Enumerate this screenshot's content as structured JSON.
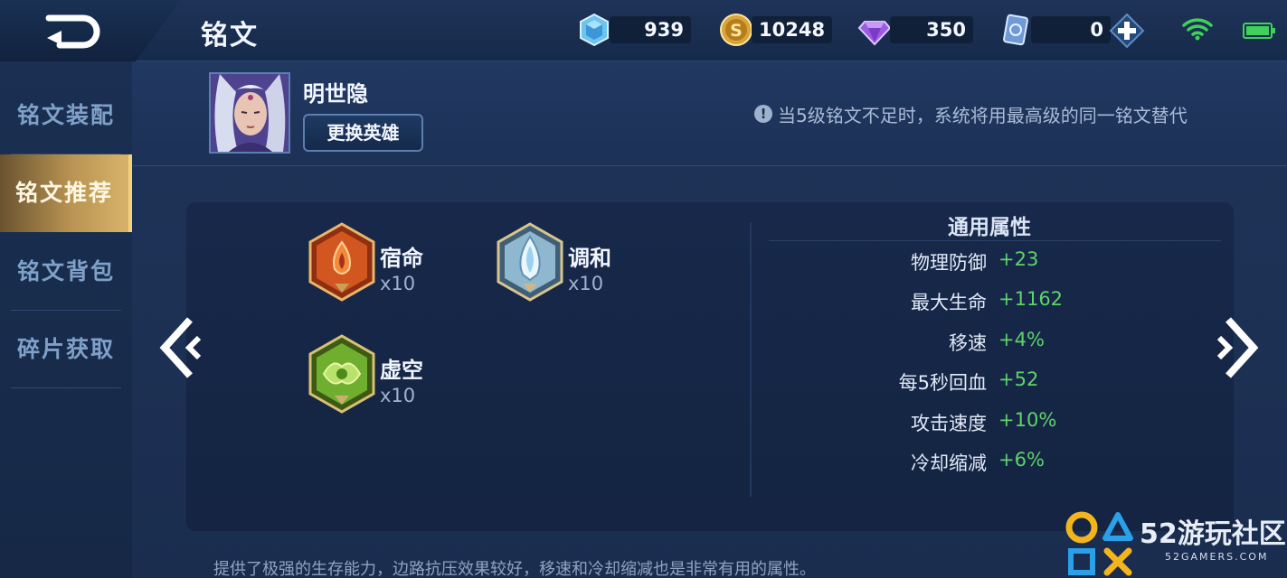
{
  "header": {
    "title": "铭文",
    "currencies": [
      {
        "icon": "blue-crystal-icon",
        "value": "939"
      },
      {
        "icon": "gold-coin-icon",
        "value": "10248"
      },
      {
        "icon": "purple-diamond-icon",
        "value": "350"
      },
      {
        "icon": "card-ticket-icon",
        "value": "0"
      }
    ]
  },
  "sidebar": {
    "items": [
      {
        "label": "铭文装配",
        "active": false
      },
      {
        "label": "铭文推荐",
        "active": true
      },
      {
        "label": "铭文背包",
        "active": false
      },
      {
        "label": "碎片获取",
        "active": false
      }
    ]
  },
  "hero": {
    "name": "明世隐",
    "change_button": "更换英雄"
  },
  "notice": {
    "icon": "!",
    "text": "当5级铭文不足时，系统将用最高级的同一铭文替代"
  },
  "runes": [
    {
      "name": "宿命",
      "count": "x10",
      "color": "#d2561f",
      "icon": "fate-rune-icon"
    },
    {
      "name": "调和",
      "count": "x10",
      "color": "#8fb7cf",
      "icon": "harmony-rune-icon"
    },
    {
      "name": "虚空",
      "count": "x10",
      "color": "#6fae2e",
      "icon": "void-rune-icon"
    }
  ],
  "attributes": {
    "title": "通用属性",
    "rows": [
      {
        "name": "物理防御",
        "value": "+23"
      },
      {
        "name": "最大生命",
        "value": "+1162"
      },
      {
        "name": "移速",
        "value": "+4%"
      },
      {
        "name": "每5秒回血",
        "value": "+52"
      },
      {
        "name": "攻击速度",
        "value": "+10%"
      },
      {
        "name": "冷却缩减",
        "value": "+6%"
      }
    ]
  },
  "footer": {
    "description": "提供了极强的生存能力，边路抗压效果较好，移速和冷却缩减也是非常有用的属性。"
  },
  "watermark": {
    "name": "52游玩社区",
    "url": "52GAMERS.COM"
  },
  "colors": {
    "accent_gold": "#d7b36a",
    "positive_green": "#5fd36a",
    "background": "#1b2c4c"
  }
}
